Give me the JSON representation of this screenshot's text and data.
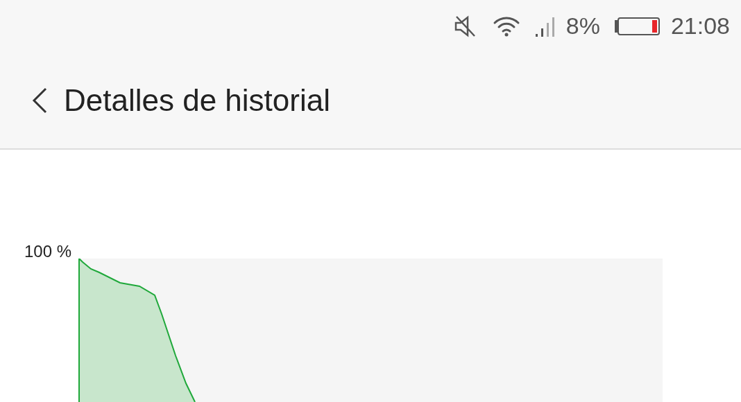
{
  "status_bar": {
    "battery_percent": "8%",
    "time": "21:08"
  },
  "header": {
    "title": "Detalles de historial"
  },
  "chart": {
    "y_tick_label": "100 %"
  }
}
